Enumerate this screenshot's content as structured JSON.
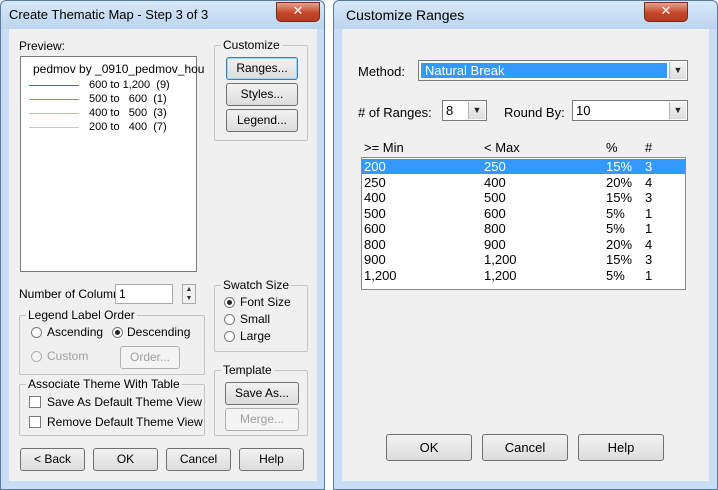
{
  "left_dialog": {
    "title": "Create Thematic Map - Step 3 of 3",
    "close_glyph": "✕",
    "preview_label": "Preview:",
    "preview": {
      "map_title": "pedmov by _0910_pedmov_hou",
      "legend": [
        {
          "text": "600 to 1,200  (9)",
          "color": "#e03030"
        },
        {
          "text": "500 to   600  (1)",
          "color": "#e86a6a"
        },
        {
          "text": "400 to   500  (3)",
          "color": "#f0a8a8"
        },
        {
          "text": "200 to   400  (7)",
          "color": "#c8c8c8"
        }
      ]
    },
    "customize": {
      "title": "Customize",
      "ranges_label": "Ranges...",
      "styles_label": "Styles...",
      "legend_label": "Legend..."
    },
    "columns": {
      "label": "Number of Columns:",
      "value": "1"
    },
    "legend_order": {
      "title": "Legend Label Order",
      "ascending": "Ascending",
      "descending": "Descending",
      "custom": "Custom",
      "order_label": "Order..."
    },
    "swatch": {
      "title": "Swatch Size",
      "font_size": "Font Size",
      "small": "Small",
      "large": "Large"
    },
    "associate": {
      "title": "Associate Theme With Table",
      "save_default": "Save As Default Theme View",
      "remove_default": "Remove Default Theme View"
    },
    "template": {
      "title": "Template",
      "save_as": "Save As...",
      "merge": "Merge..."
    },
    "buttons": {
      "back": "< Back",
      "ok": "OK",
      "cancel": "Cancel",
      "help": "Help"
    }
  },
  "right_dialog": {
    "title": "Customize Ranges",
    "close_glyph": "✕",
    "method_label": "Method:",
    "method_value": "Natural Break",
    "num_ranges_label": "# of Ranges:",
    "num_ranges_value": "8",
    "round_by_label": "Round By:",
    "round_by_value": "10",
    "columns": {
      "min": ">= Min",
      "max": "< Max",
      "pct": "%",
      "count": "#"
    },
    "rows": [
      {
        "min": "200",
        "max": "250",
        "pct": "15%",
        "count": "3"
      },
      {
        "min": "250",
        "max": "400",
        "pct": "20%",
        "count": "4"
      },
      {
        "min": "400",
        "max": "500",
        "pct": "15%",
        "count": "3"
      },
      {
        "min": "500",
        "max": "600",
        "pct": "5%",
        "count": "1"
      },
      {
        "min": "600",
        "max": "800",
        "pct": "5%",
        "count": "1"
      },
      {
        "min": "800",
        "max": "900",
        "pct": "20%",
        "count": "4"
      },
      {
        "min": "900",
        "max": "1,200",
        "pct": "15%",
        "count": "3"
      },
      {
        "min": "1,200",
        "max": "1,200",
        "pct": "5%",
        "count": "1"
      }
    ],
    "buttons": {
      "ok": "OK",
      "cancel": "Cancel",
      "help": "Help"
    }
  }
}
